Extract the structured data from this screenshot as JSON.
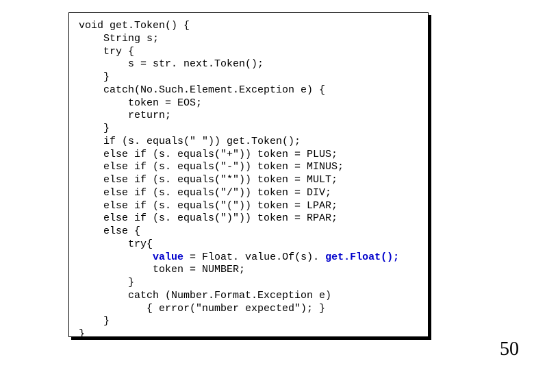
{
  "code": {
    "l1": "void get.Token() {",
    "l2": "    String s;",
    "l3": "    try {",
    "l4": "        s = str. next.Token();",
    "l5": "    }",
    "l6": "    catch(No.Such.Element.Exception e) {",
    "l7": "        token = EOS;",
    "l8": "        return;",
    "l9": "    }",
    "l10": "    if (s. equals(\" \")) get.Token();",
    "l11": "    else if (s. equals(\"+\")) token = PLUS;",
    "l12": "    else if (s. equals(\"-\")) token = MINUS;",
    "l13": "    else if (s. equals(\"*\")) token = MULT;",
    "l14": "    else if (s. equals(\"/\")) token = DIV;",
    "l15": "    else if (s. equals(\"(\")) token = LPAR;",
    "l16": "    else if (s. equals(\")\")) token = RPAR;",
    "l17": "    else {",
    "l18": "        try{",
    "l19a": "            ",
    "l19b": "value",
    "l19c": " = Float. value.Of(s).",
    "l19d": " get.Float();",
    "l20": "            token = NUMBER;",
    "l21": "        }",
    "l22": "        catch (Number.Format.Exception e)",
    "l23": "           { error(\"number expected\"); }",
    "l24": "    }",
    "l25": "}"
  },
  "page_number": "50"
}
